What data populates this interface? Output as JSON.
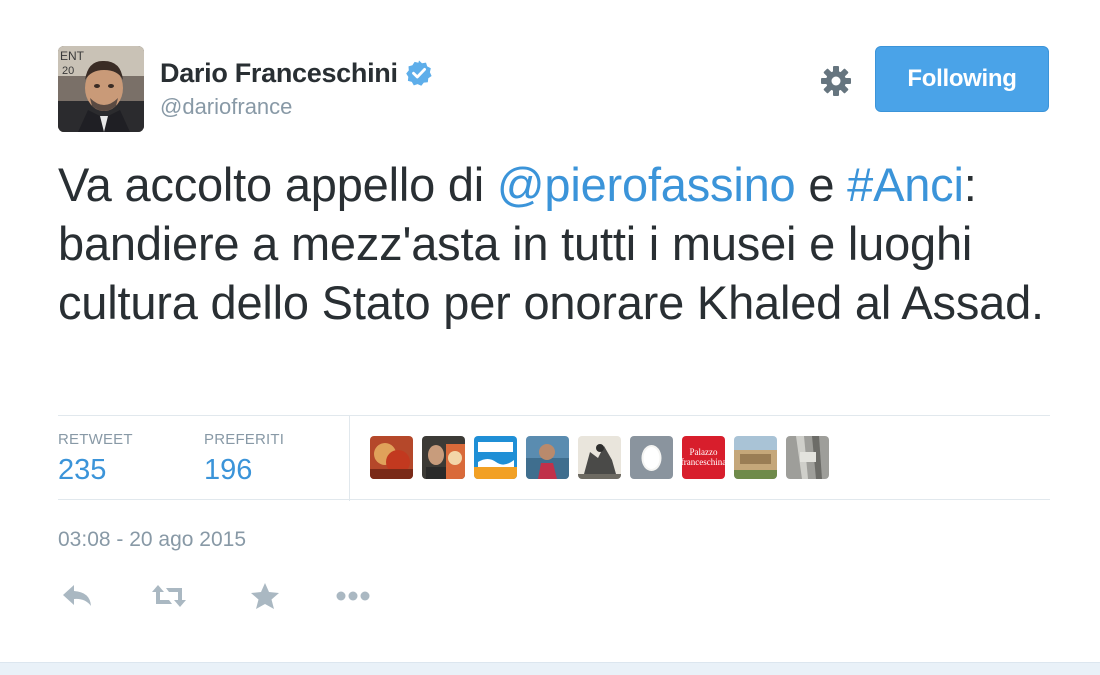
{
  "author": {
    "name": "Dario Franceschini",
    "handle": "@dariofrance",
    "verified": true
  },
  "follow_button": {
    "label": "Following",
    "color": "#4aa3e8"
  },
  "tweet": {
    "segments": [
      {
        "text": "Va accolto appello di ",
        "type": "text"
      },
      {
        "text": "@pierofassino",
        "type": "mention"
      },
      {
        "text": " e ",
        "type": "text"
      },
      {
        "text": "#Anci",
        "type": "hashtag"
      },
      {
        "text": ": bandiere a mezz'asta in tutti i musei e luoghi cultura dello Stato per onorare Khaled al Assad.",
        "type": "text"
      }
    ]
  },
  "stats": {
    "retweets": {
      "label": "RETWEET",
      "value": "235"
    },
    "favorites": {
      "label": "PREFERITI",
      "value": "196"
    }
  },
  "favoriters": {
    "avatars": [
      "avatar-1",
      "avatar-2",
      "avatar-3",
      "avatar-4",
      "avatar-5",
      "avatar-6",
      "avatar-7",
      "avatar-8",
      "avatar-9"
    ],
    "palazzo_text": "Palazzo franceschina"
  },
  "timestamp": "03:08 - 20 ago 2015",
  "actions": [
    "reply-icon",
    "retweet-icon",
    "favorite-icon",
    "more-icon"
  ],
  "colors": {
    "link": "#3b94d9",
    "muted": "#8899a6",
    "text": "#292f33",
    "action_icon": "#aab8c2"
  }
}
